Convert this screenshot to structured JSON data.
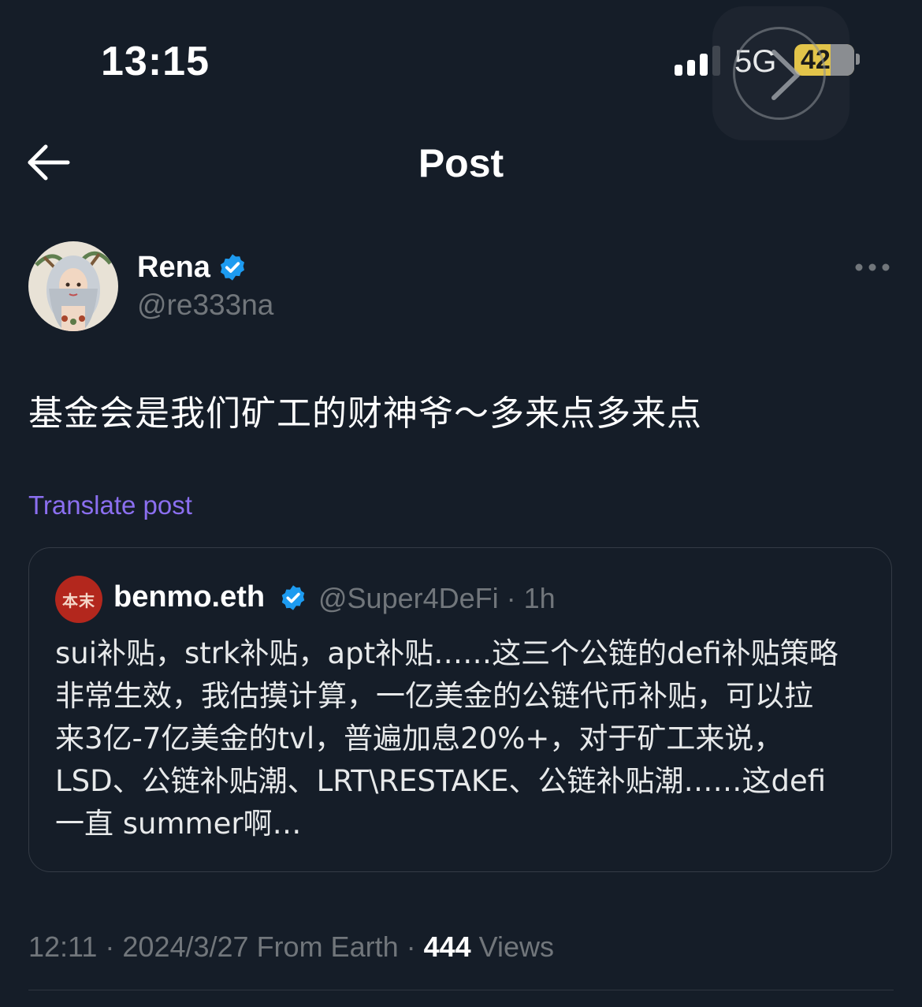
{
  "status_bar": {
    "time": "13:15",
    "network": "5G",
    "battery": "42",
    "battery_level": 0.42
  },
  "header": {
    "title": "Post"
  },
  "author": {
    "name": "Rena",
    "handle": "@re333na",
    "verified": true
  },
  "post": {
    "text": "基金会是我们矿工的财神爷～多来点多来点",
    "translate_label": "Translate post"
  },
  "quote": {
    "avatar_text": "本末",
    "name": "benmo.eth",
    "handle": "@Super4DeFi · 1h",
    "verified": true,
    "lines": [
      "sui补贴，strk补贴，apt补贴……这三个公链的defi补贴策略",
      "非常生效，我估摸计算，一亿美金的公链代币补贴，可以拉",
      "来3亿-7亿美金的tvl，普遍加息20%+，对于矿工来说，",
      "LSD、公链补贴潮、LRT\\RESTAKE、公链补贴潮……这defi",
      "一直 summer啊…"
    ]
  },
  "meta": {
    "time_date": "12:11 · 2024/3/27 From Earth · ",
    "views_count": "444",
    "views_label": " Views"
  },
  "colors": {
    "background": "#151d28",
    "accent_link": "#8b6ff0",
    "verified": "#1d9bf0",
    "battery": "#e2c44a"
  },
  "icons": {
    "back": "arrow-left-icon",
    "verified": "verified-badge-icon",
    "more": "more-horizontal-icon",
    "signal": "cellular-signal-icon",
    "battery": "battery-charging-icon"
  }
}
